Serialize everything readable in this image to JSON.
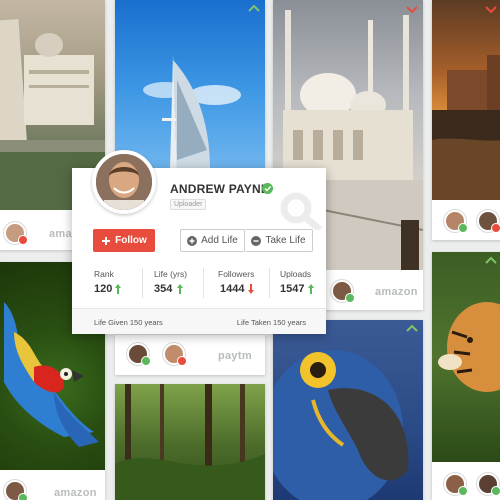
{
  "profile": {
    "name": "ANDREW PAYNE",
    "role": "Uploader",
    "follow_label": "Follow",
    "add_life_label": "Add Life",
    "take_life_label": "Take Life",
    "stats": [
      {
        "label": "Rank",
        "value": "120",
        "trend": "up"
      },
      {
        "label": "Life (yrs)",
        "value": "354",
        "trend": "up"
      },
      {
        "label": "Followers",
        "value": "1444",
        "trend": "down"
      },
      {
        "label": "Uploads",
        "value": "1547",
        "trend": "up"
      }
    ],
    "life_given": "Life Given 150 years",
    "life_taken": "Life Taken 150 years"
  },
  "brands": {
    "amazon": "amazon",
    "paytm": "paytm"
  },
  "colors": {
    "accent_red": "#e74c3c",
    "accent_green": "#5cb85c",
    "up_arrow": "#5cb85c",
    "down_arrow": "#e74c3c"
  },
  "icons": [
    "chevron-up-icon",
    "chevron-down-icon",
    "plus-icon",
    "minus-icon",
    "arrow-up-icon",
    "arrow-down-icon",
    "check-icon"
  ]
}
